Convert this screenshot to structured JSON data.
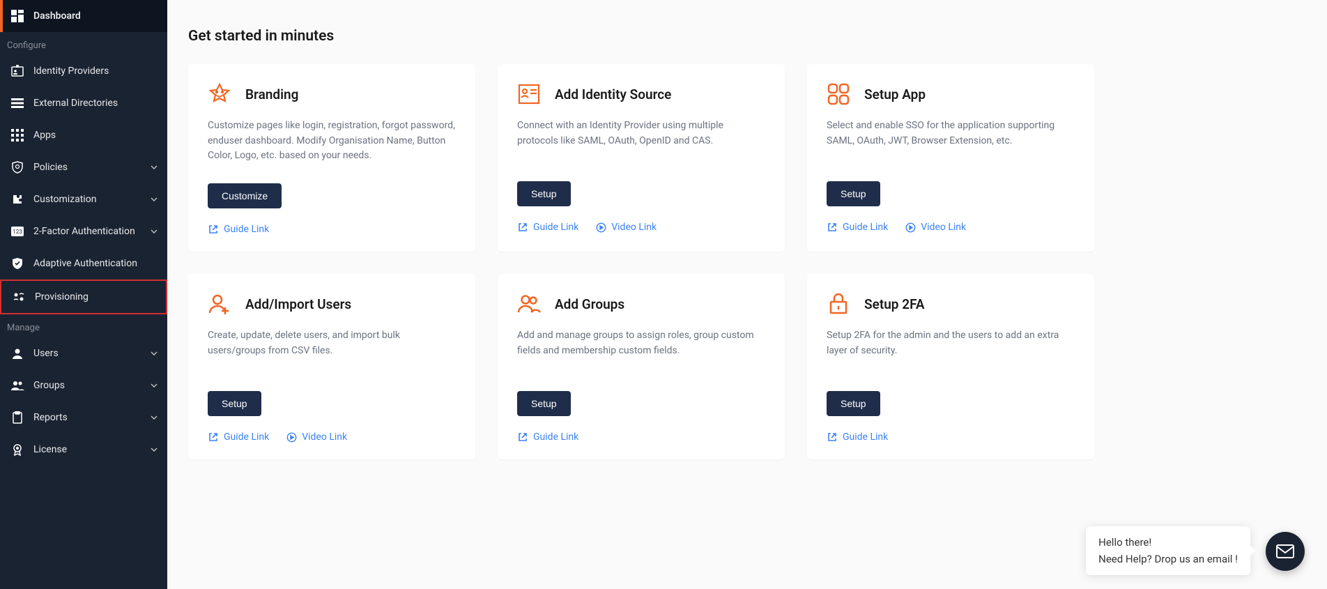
{
  "colors": {
    "accent": "#f26522",
    "navy": "#1f2d4a",
    "link": "#3b82f6"
  },
  "sidebar": {
    "items": [
      {
        "label": "Dashboard"
      },
      {
        "label": "Identity Providers"
      },
      {
        "label": "External Directories"
      },
      {
        "label": "Apps"
      },
      {
        "label": "Policies"
      },
      {
        "label": "Customization"
      },
      {
        "label": "2-Factor Authentication"
      },
      {
        "label": "Adaptive Authentication"
      },
      {
        "label": "Provisioning"
      },
      {
        "label": "Users"
      },
      {
        "label": "Groups"
      },
      {
        "label": "Reports"
      },
      {
        "label": "License"
      }
    ],
    "sections": {
      "configure": "Configure",
      "manage": "Manage"
    }
  },
  "page": {
    "title": "Get started in minutes"
  },
  "cards": [
    {
      "title": "Branding",
      "desc": "Customize pages like login, registration, forgot password, enduser dashboard. Modify Organisation Name, Button Color, Logo, etc. based on your needs.",
      "btn": "Customize",
      "guide": "Guide Link"
    },
    {
      "title": "Add Identity Source",
      "desc": "Connect with an Identity Provider using multiple protocols like SAML, OAuth, OpenID and CAS.",
      "btn": "Setup",
      "guide": "Guide Link",
      "video": "Video Link"
    },
    {
      "title": "Setup App",
      "desc": "Select and enable SSO for the application supporting SAML, OAuth, JWT, Browser Extension, etc.",
      "btn": "Setup",
      "guide": "Guide Link",
      "video": "Video Link"
    },
    {
      "title": "Add/Import Users",
      "desc": "Create, update, delete users, and import bulk users/groups from CSV files.",
      "btn": "Setup",
      "guide": "Guide Link",
      "video": "Video Link"
    },
    {
      "title": "Add Groups",
      "desc": "Add and manage groups to assign roles, group custom fields and membership custom fields.",
      "btn": "Setup",
      "guide": "Guide Link"
    },
    {
      "title": "Setup 2FA",
      "desc": "Setup 2FA for the admin and the users to add an extra layer of security.",
      "btn": "Setup",
      "guide": "Guide Link"
    }
  ],
  "chat": {
    "line1": "Hello there!",
    "line2": "Need Help? Drop us an email !"
  }
}
